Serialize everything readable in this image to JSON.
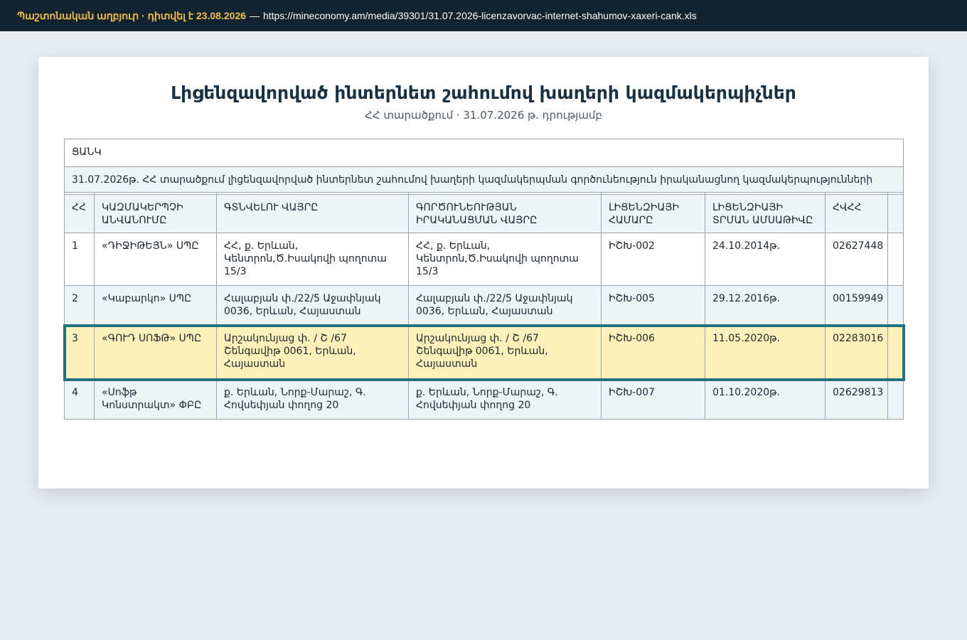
{
  "source_bar": {
    "label": "Պաշտոնական աղբյուր · դիտվել է 23.08.2026",
    "separator": "—",
    "url": "https://mineconomy.am/media/39301/31.07.2026-licenzavorvac-internet-shahumov-xaxeri-cank.xls"
  },
  "document": {
    "title": "Լիցենզավորված ինտերնետ շահումով խաղերի կազմակերպիչներ",
    "subtitle": "ՀՀ տարածքում · 31.07.2026 թ. դրությամբ"
  },
  "table": {
    "caption": "ՑԱՆԿ",
    "description": "31.07.2026թ. ՀՀ տարածքում լիցենզավորված ինտերնետ շահումով խաղերի կազմակերպման գործունեություն իրականացնող կազմակերպությունների",
    "headers": [
      "ՀՀ",
      "ԿԱԶՄԱԿԵՐՊՉԻ ԱՆՎԱՆՈՒՄԸ",
      "ԳՏՆՎԵԼՈՒ ՎԱՅՐԸ",
      "ԳՈՐԾՈՒՆԵՈՒԹՅԱՆ ԻՐԱԿԱՆԱՑՄԱՆ ՎԱՅՐԸ",
      "ԼԻՑԵՆԶԻԱՅԻ ՀԱՄԱՐԸ",
      "ԼԻՑԵՆԶԻԱՅԻ ՏՐՄԱՆ ԱՄՍԱԹԻՎԸ",
      "ՀՎՀՀ",
      ""
    ],
    "rows": [
      [
        "1",
        "«ԴԻՋԻԹԵՅՆ» ՍՊԸ",
        "ՀՀ, ք. Երևան, Կենտրոն,Ծ.Իսակովի պողոտա 15/3",
        "ՀՀ, ք. Երևան, Կենտրոն,Ծ.Իսակովի պողոտա 15/3",
        "ԻՇԽ-002",
        "24.10.2014թ.",
        "02627448",
        ""
      ],
      [
        "2",
        "«Կաբարկո» ՍՊԸ",
        "Հալաբյան փ./22/5 Աջափնյակ 0036, Երևան, Հայաստան",
        "Հալաբյան փ./22/5 Աջափնյակ 0036, Երևան, Հայաստան",
        "ԻՇԽ-005",
        "29.12.2016թ.",
        "00159949",
        ""
      ],
      [
        "3",
        "«ԳՈՒԴ ՍՈՖԹ» ՍՊԸ",
        "Արշակունյաց փ. / Շ /67 Շենգավիթ 0061, Երևան, Հայաստան",
        "Արշակունյաց փ. / Շ /67 Շենգավիթ 0061, Երևան, Հայաստան",
        "ԻՇԽ-006",
        "11.05.2020թ.",
        "02283016",
        ""
      ],
      [
        "4",
        "«Սոֆթ Կոնստրակտ» ՓԲԸ",
        "ք. Երևան, Նորք-Մարաշ, Գ. Հովսեփյան փողոց 20",
        "ք. Երևան, Նորք-Մարաշ, Գ. Հովսեփյան փողոց 20",
        "ԻՇԽ-007",
        "01.10.2020թ.",
        "02629813",
        ""
      ]
    ]
  },
  "colors": {
    "topbar_bg": "#12232f",
    "source_label": "#f2c04b",
    "highlight_fill": "#fdf0b8",
    "highlight_border": "#217382",
    "row_tint": "#eef3f6"
  }
}
